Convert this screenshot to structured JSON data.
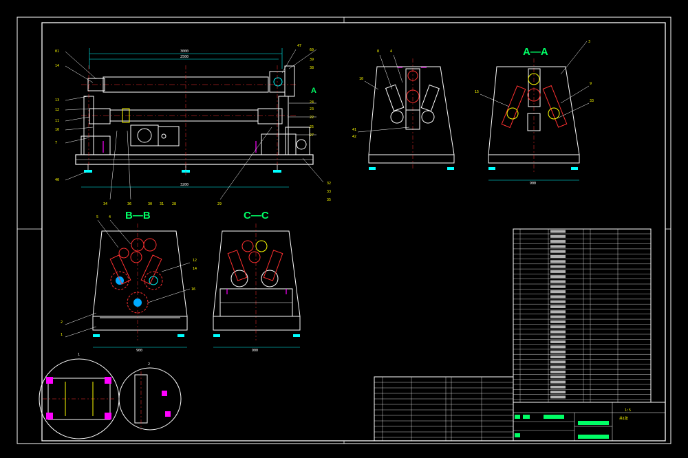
{
  "drawing": {
    "section_labels": {
      "a_a": "A—A",
      "b_b": "B—B",
      "c_c": "C—C",
      "a_marker": "A"
    },
    "colors": {
      "background": "#000000",
      "outline": "#ffffff",
      "centerline": "#ff3030",
      "section_text": "#00ff66",
      "dimension": "#00ffff",
      "hatch_magenta": "#ff00ff",
      "part_yellow": "#ffff00",
      "roller_cyan": "#00ffff"
    },
    "icons": [
      "roller-circle-icon",
      "foot-pad-icon",
      "motor-icon",
      "leader-balloon-icon"
    ]
  },
  "title_block": {
    "scale": "1:5",
    "sheet": "共1张"
  }
}
